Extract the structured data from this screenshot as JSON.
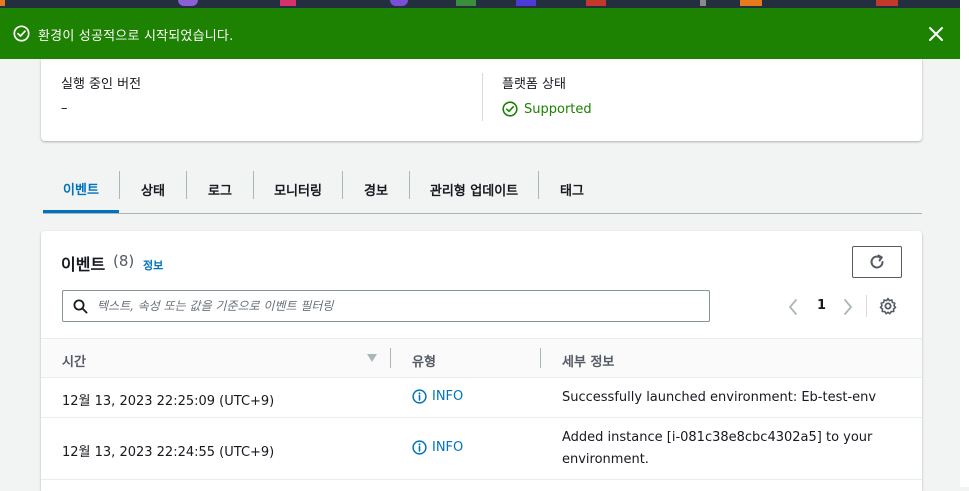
{
  "colors": {
    "success": "#1d8102",
    "link": "#0073bb",
    "top_strip": "#232f3e"
  },
  "flash": {
    "icon": "check-circle-icon",
    "message": "환경이 성공적으로 시작되었습니다.",
    "close_icon": "close-icon"
  },
  "summary": {
    "running_version_label": "실행 중인 버전",
    "running_version_value": "–",
    "platform_state_label": "플랫폼 상태",
    "platform_state_value": "Supported"
  },
  "tabs": [
    {
      "label": "이벤트",
      "active": true
    },
    {
      "label": "상태",
      "active": false
    },
    {
      "label": "로그",
      "active": false
    },
    {
      "label": "모니터링",
      "active": false
    },
    {
      "label": "경보",
      "active": false
    },
    {
      "label": "관리형 업데이트",
      "active": false
    },
    {
      "label": "태그",
      "active": false
    }
  ],
  "events": {
    "title": "이벤트",
    "count": "(8)",
    "info_link": "정보",
    "search_placeholder": "텍스트, 속성 또는 값을 기준으로 이벤트 필터링",
    "page": "1",
    "columns": [
      "시간",
      "유형",
      "세부 정보"
    ],
    "rows": [
      {
        "time": "12월 13, 2023 22:25:09 (UTC+9)",
        "type": "INFO",
        "details": "Successfully launched environment: Eb-test-env"
      },
      {
        "time": "12월 13, 2023 22:24:55 (UTC+9)",
        "type": "INFO",
        "details_line1": "Added instance [i-081c38e8cbc4302a5] to your",
        "details_line2": "environment."
      }
    ]
  }
}
